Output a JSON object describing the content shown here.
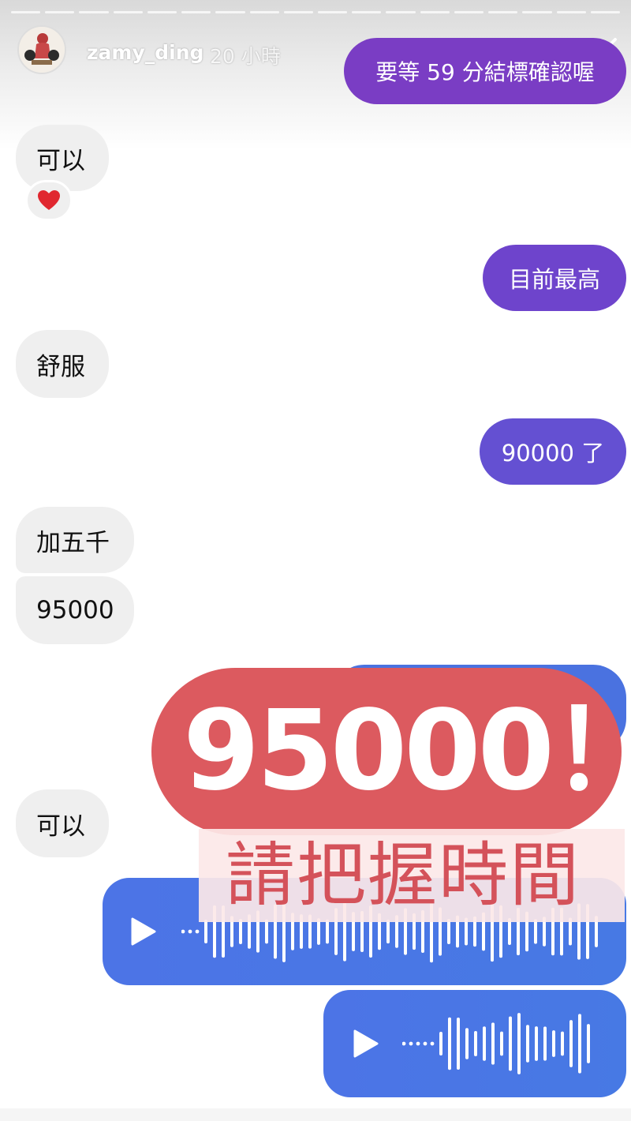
{
  "story": {
    "username": "zamy_ding",
    "time_ago": "20 小時",
    "menu_icon": "more-horizontal-icon",
    "close_icon": "close-icon",
    "segments": 18
  },
  "messages": {
    "m1_out": "要等 59 分結標確認喔",
    "m2_in": "可以",
    "reaction": "❤️",
    "m3_out": "目前最高",
    "m4_in": "舒服",
    "m5_out": "90000 了",
    "m6_in": "加五千",
    "m7_in": "95000",
    "m8_in": "可以"
  },
  "overlay": {
    "headline": "95000！",
    "subline": "請把握時間"
  },
  "colors": {
    "purple_top": "#7a3dc4",
    "purple_mid": "#6a48cf",
    "blue": "#4a76e4",
    "overlay_red": "#dc5a5f",
    "overlay_pink_text": "#d4525a"
  }
}
